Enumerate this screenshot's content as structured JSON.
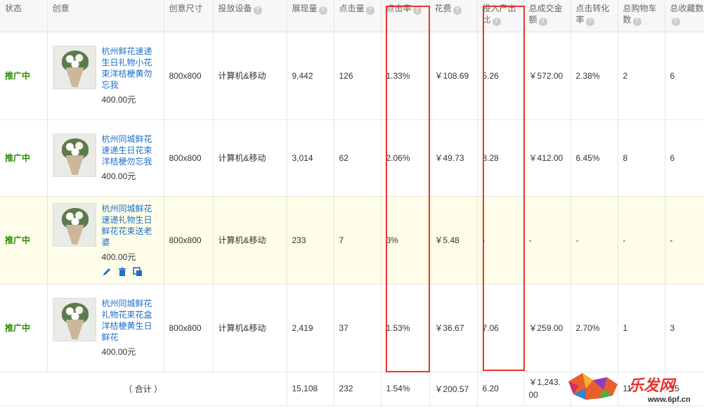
{
  "headers": {
    "status": "状态",
    "creative": "创意",
    "size": "创意尺寸",
    "device": "投放设备",
    "impressions": "展现量",
    "clicks": "点击量",
    "ctr": "点击率",
    "cost": "花费",
    "roi": "投入产出比",
    "gmv": "总成交金额",
    "cvr": "点击转化率",
    "carts": "总购物车数",
    "favs": "总收藏数"
  },
  "rows": [
    {
      "status": "推广中",
      "title": "杭州鲜花速递生日礼物小花束洋桔梗黄勿忘我",
      "price": "400.00元",
      "size": "800x800",
      "device": "计算机&移动",
      "impressions": "9,442",
      "clicks": "126",
      "ctr": "1.33%",
      "cost": "￥108.69",
      "roi": "5.26",
      "gmv": "￥572.00",
      "cvr": "2.38%",
      "carts": "2",
      "favs": "6"
    },
    {
      "status": "推广中",
      "title": "杭州同城鲜花速递生日花束洋桔梗勿忘我",
      "price": "400.00元",
      "size": "800x800",
      "device": "计算机&移动",
      "impressions": "3,014",
      "clicks": "62",
      "ctr": "2.06%",
      "cost": "￥49.73",
      "roi": "8.28",
      "gmv": "￥412.00",
      "cvr": "6.45%",
      "carts": "8",
      "favs": "6"
    },
    {
      "status": "推广中",
      "title": "杭州同城鲜花速递礼物生日鲜花花束送老婆",
      "price": "400.00元",
      "size": "800x800",
      "device": "计算机&移动",
      "impressions": "233",
      "clicks": "7",
      "ctr": "3%",
      "cost": "￥5.48",
      "roi": "-",
      "gmv": "-",
      "cvr": "-",
      "carts": "-",
      "favs": "-"
    },
    {
      "status": "推广中",
      "title": "杭州同城鲜花礼物花束花盒洋桔梗黄生日鲜花",
      "price": "400.00元",
      "size": "800x800",
      "device": "计算机&移动",
      "impressions": "2,419",
      "clicks": "37",
      "ctr": "1.53%",
      "cost": "￥36.67",
      "roi": "7.06",
      "gmv": "￥259.00",
      "cvr": "2.70%",
      "carts": "1",
      "favs": "3"
    }
  ],
  "total": {
    "label": "（ 合计 ）",
    "impressions": "15,108",
    "clicks": "232",
    "ctr": "1.54%",
    "cost": "￥200.57",
    "roi": "6.20",
    "gmv": "￥1,243.00",
    "carts": "11",
    "favs": "15"
  },
  "watermark": {
    "text": "乐发网",
    "url": "www.6pf.cn"
  },
  "colors": {
    "status": "#2b8a00",
    "link": "#1f6fc5",
    "highlight_row": "#fdfde9",
    "red_box": "#e8352d"
  },
  "icons": [
    "edit-icon",
    "delete-icon",
    "copy-icon",
    "help-icon"
  ]
}
